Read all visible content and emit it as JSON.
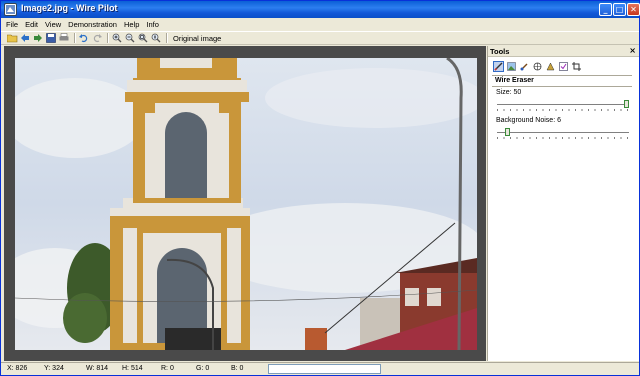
{
  "window": {
    "title": "Image2.jpg - Wire Pilot"
  },
  "title_buttons": {
    "minimize": "_",
    "maximize": "□",
    "close": "✕"
  },
  "menu": [
    "File",
    "Edit",
    "View",
    "Demonstration",
    "Help",
    "Info"
  ],
  "toolbar": {
    "icons": [
      "open-folder-icon",
      "back-arrow-icon",
      "forward-arrow-icon",
      "save-icon",
      "print-icon",
      "undo-icon",
      "redo-icon",
      "zoom-in-icon",
      "zoom-out-icon",
      "zoom-fit-icon",
      "zoom-actual-icon"
    ],
    "original_image_label": "Original image"
  },
  "tools": {
    "title": "Tools",
    "close": "×",
    "icons": [
      "wire-eraser-icon",
      "image-icon",
      "brush-icon",
      "stamp-icon",
      "triangle-icon",
      "checkbox-icon",
      "crop-icon"
    ],
    "selected_tool": "Wire Eraser",
    "size_label": "Size: 50",
    "size_value": 50,
    "size_max": 50,
    "noise_label": "Background Noise: 6",
    "noise_value": 6,
    "noise_max": 100
  },
  "status": {
    "x": "X: 826",
    "y": "Y: 324",
    "w": "W: 814",
    "h": "H: 514",
    "r": "R: 0",
    "g": "G: 0",
    "b": "B: 0"
  },
  "colors": {
    "titlebar": "#0a5fd6",
    "canvas_bg": "#4a4a4a",
    "tower_yellow": "#c9963a",
    "tower_white": "#e8e4dc",
    "sky": "#c8d6ea"
  }
}
